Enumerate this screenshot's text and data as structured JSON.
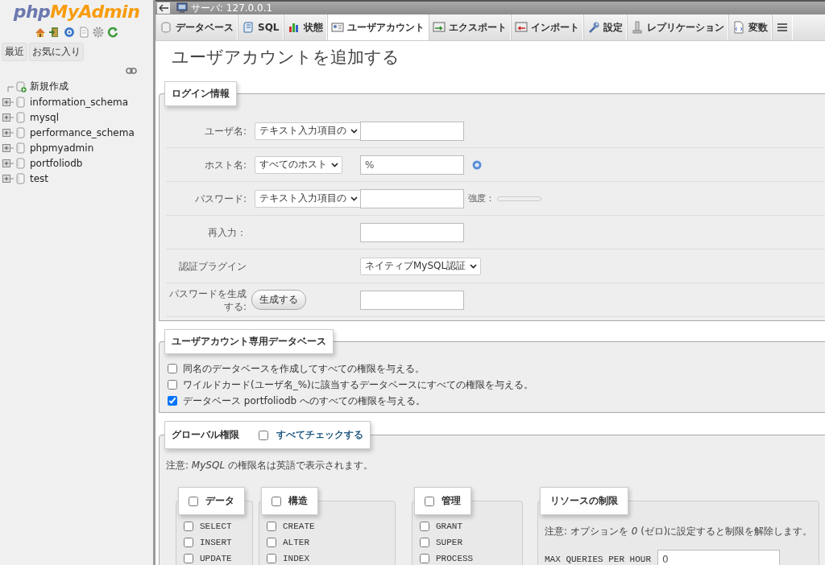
{
  "sidebar": {
    "logo": {
      "part_1": "php",
      "part_2": "MyAdmin"
    },
    "tabs": [
      {
        "label": "最近"
      },
      {
        "label": "お気に入り"
      }
    ],
    "tree": [
      {
        "label": "新規作成",
        "kind": "new"
      },
      {
        "label": "information_schema",
        "kind": "database"
      },
      {
        "label": "mysql",
        "kind": "database"
      },
      {
        "label": "performance_schema",
        "kind": "database"
      },
      {
        "label": "phpmyadmin",
        "kind": "database"
      },
      {
        "label": "portfoliodb",
        "kind": "database"
      },
      {
        "label": "test",
        "kind": "database"
      }
    ]
  },
  "breadcrumb": {
    "label": "サーバ: 127.0.0.1"
  },
  "tabs": [
    {
      "label": "データベース",
      "selected": false
    },
    {
      "label": "SQL",
      "selected": false
    },
    {
      "label": "状態",
      "selected": false
    },
    {
      "label": "ユーザアカウント",
      "selected": true
    },
    {
      "label": "エクスポート",
      "selected": false
    },
    {
      "label": "インポート",
      "selected": false
    },
    {
      "label": "設定",
      "selected": false
    },
    {
      "label": "レプリケーション",
      "selected": false
    },
    {
      "label": "変数",
      "selected": false
    },
    {
      "kind": "menu",
      "selected": false
    }
  ],
  "heading": "ユーザアカウントを追加する",
  "login_info": {
    "legend": "ログイン情報",
    "rows": [
      {
        "kind": "select_input",
        "label": "ユーザ名:",
        "select": "テキスト入力項目の"
      },
      {
        "kind": "select_input",
        "label": "ホスト名:",
        "select": "すべてのホスト",
        "value": "%",
        "help": true
      },
      {
        "kind": "select_input",
        "label": "パスワード:",
        "select": "テキスト入力項目の",
        "strength": {
          "label": "強度：",
          "level": 0
        }
      },
      {
        "kind": "input",
        "label": "再入力："
      },
      {
        "kind": "select",
        "label": "認証プラグイン",
        "select": "ネイティブMySQL認証"
      },
      {
        "kind": "button_input",
        "label": "パスワードを生成する:",
        "button": "生成する"
      }
    ]
  },
  "user_database": {
    "legend": "ユーザアカウント専用データベース",
    "options": [
      {
        "label": "同名のデータベースを作成してすべての権限を与える。",
        "checked": false
      },
      {
        "label": "ワイルドカード(ユーザ名_%)に該当するデータベースにすべての権限を与える。",
        "checked": false
      },
      {
        "label": "データベース portfoliodb へのすべての権限を与える。",
        "checked": true
      }
    ]
  },
  "global_privileges": {
    "legend": "グローバル権限",
    "check_all": {
      "label": "すべてチェックする",
      "checked": false
    },
    "note": "注意: *MySQL* の権限名は英語で表示されます。",
    "groups": [
      {
        "title": "データ",
        "checked": false,
        "items": [
          {
            "label": "SELECT",
            "checked": false
          },
          {
            "label": "INSERT",
            "checked": false
          },
          {
            "label": "UPDATE",
            "checked": false
          }
        ]
      },
      {
        "title": "構造",
        "checked": false,
        "items": [
          {
            "label": "CREATE",
            "checked": false
          },
          {
            "label": "ALTER",
            "checked": false
          },
          {
            "label": "INDEX",
            "checked": false
          }
        ]
      },
      {
        "title": "管理",
        "checked": false,
        "items": [
          {
            "label": "GRANT",
            "checked": false
          },
          {
            "label": "SUPER",
            "checked": false
          },
          {
            "label": "PROCESS",
            "checked": false
          }
        ]
      }
    ],
    "resource_limits": {
      "legend": "リソースの制限",
      "note": "注意: オプションを *0* (ゼロ)に設定すると制限を解除します。",
      "fields": [
        {
          "label": "MAX QUERIES PER HOUR",
          "value": "0"
        }
      ]
    }
  }
}
